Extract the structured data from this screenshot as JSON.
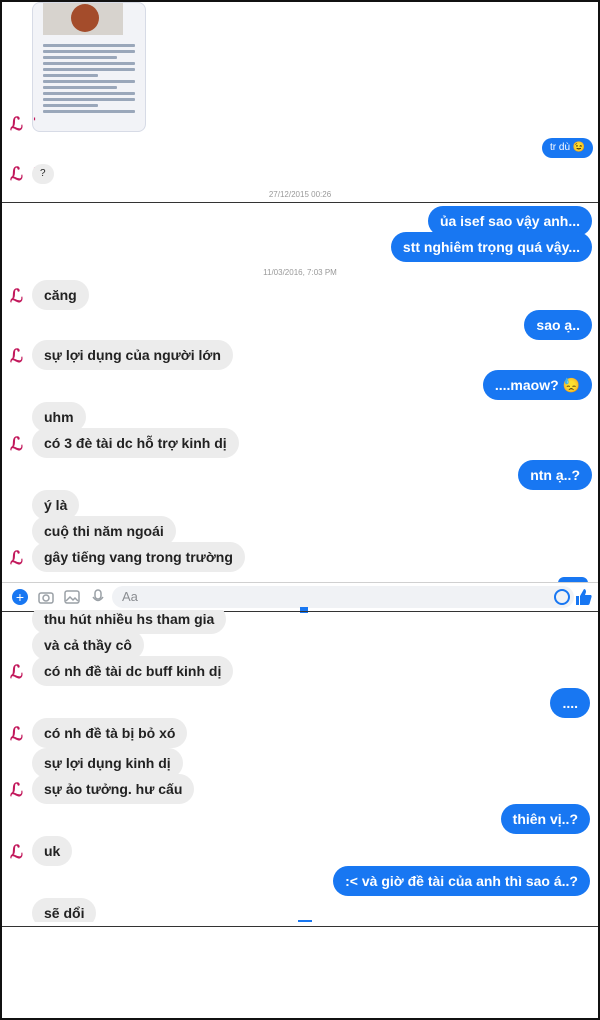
{
  "section1": {
    "messages": {
      "trdu": "tr dù",
      "question": "?"
    },
    "timestamp": "27/12/2015 00:26",
    "emoji": "😉"
  },
  "section2": {
    "messages": {
      "out1": "ủa isef sao vậy anh...",
      "out2": "stt nghiêm trọng quá vậy...",
      "timestamp": "11/03/2016, 7:03 PM",
      "in1": "căng",
      "out3": "sao ạ..",
      "in2": "sự lợi dụng của người lớn",
      "out4": "....maow?",
      "in3": "uhm",
      "in4": "có 3 đè tài dc hỗ trợ kinh dị",
      "out5": "ntn ạ..?",
      "in5": "ý là",
      "in6": "cuộ thi năm ngoái",
      "in7": "gây tiếng vang trong trường"
    },
    "emoji_maow": "😓"
  },
  "composer": {
    "placeholder": "Aa"
  },
  "section3": {
    "messages": {
      "in1": "thu hút nhiều hs tham gia",
      "in2": "và cả thầy cô",
      "in3": "có nh đề tài dc buff kinh dị",
      "out1": "....",
      "in4": "có nh đề tà bị bỏ xó",
      "in5": "sự lợi dụng kinh dị",
      "in6": "sự ảo tưởng. hư cấu",
      "out2": "thiên vị..?",
      "in7": "uk",
      "out3": ":< và giờ đề tài của anh thì sao á..?",
      "in8": "sẽ dổi"
    }
  },
  "colors": {
    "outgoing": "#1877f2",
    "incoming": "#ececec",
    "avatar": "#c2185b"
  },
  "icons": [
    "plus-icon",
    "camera-icon",
    "image-icon",
    "microphone-icon",
    "emoji-icon",
    "like-icon",
    "avatar-icon"
  ]
}
